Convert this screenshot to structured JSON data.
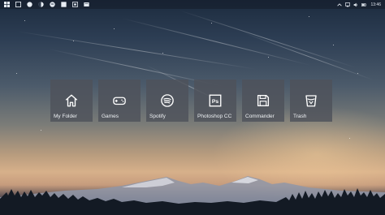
{
  "taskbar": {
    "left_icons": [
      {
        "name": "windows-start-icon"
      },
      {
        "name": "search-icon"
      },
      {
        "name": "circle-app-icon"
      },
      {
        "name": "halfmoon-app-icon"
      },
      {
        "name": "spotify-app-icon"
      },
      {
        "name": "photoshop-app-icon"
      },
      {
        "name": "image-app-icon"
      },
      {
        "name": "folder-app-icon"
      }
    ],
    "tray_icons": [
      {
        "name": "chevron-up-icon"
      },
      {
        "name": "network-icon"
      },
      {
        "name": "volume-icon"
      },
      {
        "name": "battery-icon"
      }
    ],
    "clock": "13:46"
  },
  "tiles": [
    {
      "label": "My Folder",
      "icon": "home-icon"
    },
    {
      "label": "Games",
      "icon": "gamepad-icon"
    },
    {
      "label": "Spotify",
      "icon": "spotify-icon"
    },
    {
      "label": "Photoshop CC",
      "icon": "photoshop-icon"
    },
    {
      "label": "Commander",
      "icon": "save-icon"
    },
    {
      "label": "Trash",
      "icon": "trash-icon"
    }
  ],
  "colors": {
    "tile_bg": "#4e525a",
    "tile_text": "#eef1f4"
  }
}
